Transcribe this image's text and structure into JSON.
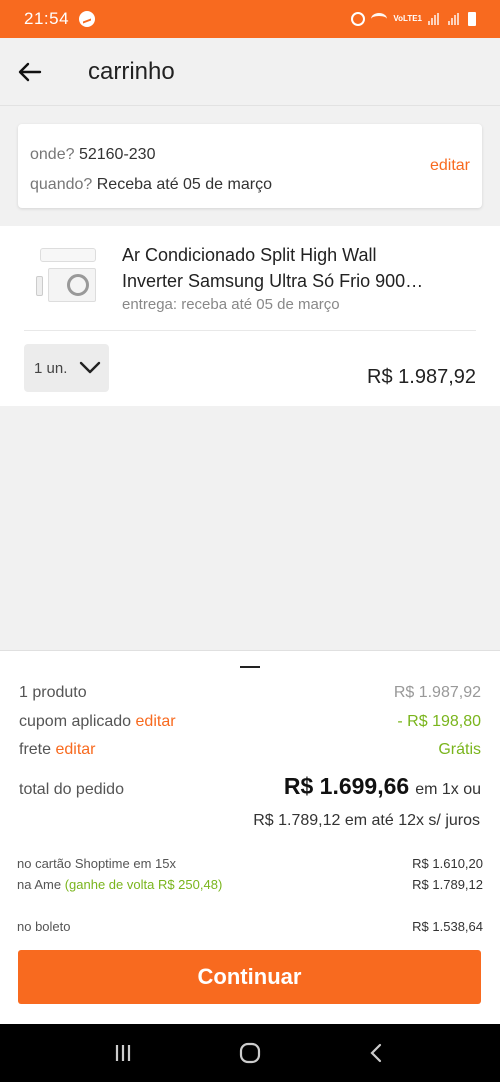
{
  "status_bar": {
    "time": "21:54",
    "network_label": "VoLTE1"
  },
  "header": {
    "title": "carrinho"
  },
  "address": {
    "where_label": "onde?",
    "where_value": "52160-230",
    "when_label": "quando?",
    "when_value": "Receba até 05 de março",
    "edit_label": "editar"
  },
  "product": {
    "name_line1": "Ar Condicionado Split High Wall",
    "name_line2": "Inverter Samsung Ultra Só Frio 900…",
    "delivery": "entrega: receba até 05 de março",
    "quantity": "1 un.",
    "price": "R$ 1.987,92"
  },
  "summary": {
    "products_label": "1 produto",
    "products_value": "R$ 1.987,92",
    "coupon_label": "cupom aplicado",
    "coupon_edit": "editar",
    "coupon_value": "- R$ 198,80",
    "shipping_label": "frete",
    "shipping_edit": "editar",
    "shipping_value": "Grátis",
    "total_label": "total do pedido",
    "total_value": "R$ 1.699,66",
    "total_suffix": "em 1x ou",
    "installments": "R$ 1.789,12 em até 12x s/ juros",
    "card_label": "no cartão Shoptime em 15x",
    "card_value": "R$ 1.610,20",
    "ame_label": "na Ame",
    "ame_cashback": "(ganhe de volta R$ 250,48)",
    "ame_value": "R$ 1.789,12",
    "boleto_label": "no boleto",
    "boleto_value": "R$ 1.538,64",
    "continue_label": "Continuar"
  },
  "colors": {
    "accent": "#f86a1f",
    "success": "#7ab51d"
  }
}
